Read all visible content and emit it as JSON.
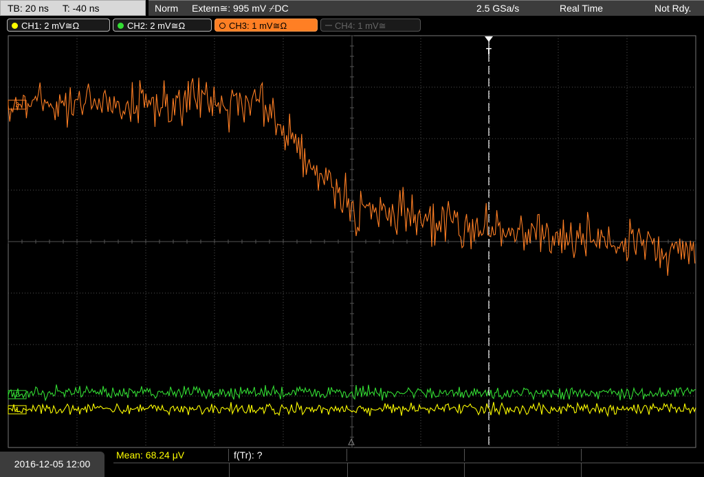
{
  "topbar": {
    "tb_label": "TB: 20 ns",
    "trig_time_label": "T: -40 ns",
    "mode": "Norm",
    "trigger_source": "Extern≅: 995 mV ⌿DC",
    "sample_rate": "2.5 GSa/s",
    "acq_mode": "Real Time",
    "status": "Not Rdy."
  },
  "channels": [
    {
      "label": "CH1: 2 mV≅Ω",
      "color": "#ffff00",
      "active": true
    },
    {
      "label": "CH2: 2 mV≅Ω",
      "color": "#33dd33",
      "active": true
    },
    {
      "label": "CH3: 1 mV≅Ω",
      "color": "#ff7f24",
      "active": true
    },
    {
      "label": "CH4: 1 mV≅",
      "color": "#555555",
      "active": false
    }
  ],
  "markers": {
    "trigger_marker": "T",
    "ch3_marker": "3",
    "ch2_marker": "2",
    "ch1_marker": "1"
  },
  "measurements": {
    "mean": "Mean: 68.24 μV",
    "freq": "f(Tr): ?"
  },
  "footer": {
    "datetime": "2016-12-05 12:00"
  },
  "colors": {
    "grid": "#555555",
    "ch1": "#ffff00",
    "ch2": "#33dd33",
    "ch3": "#ff7f24"
  }
}
